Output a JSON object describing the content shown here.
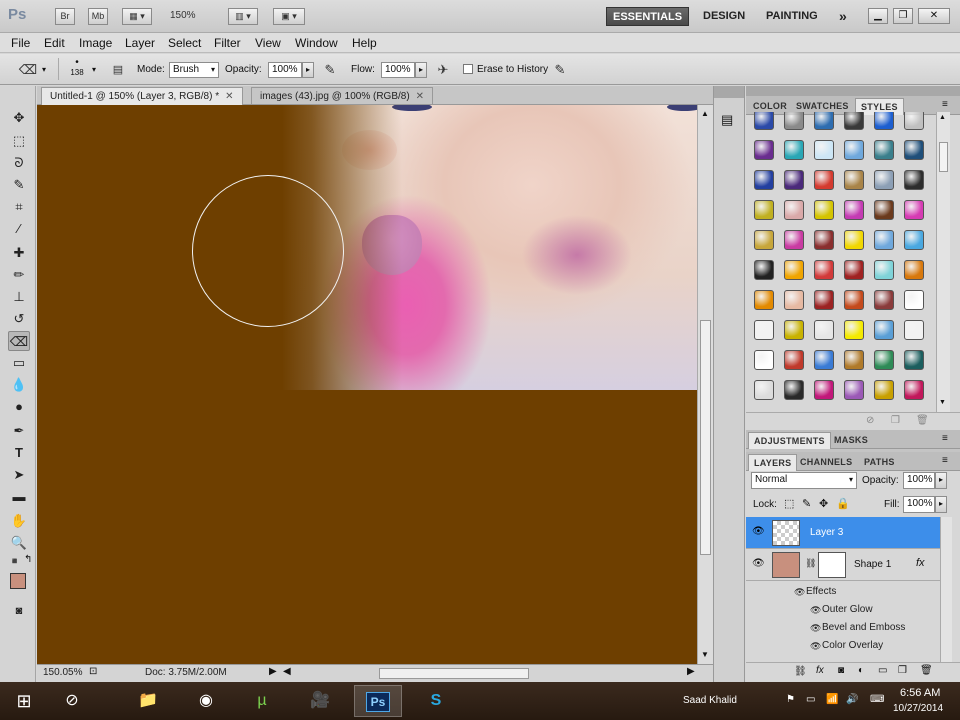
{
  "appbar": {
    "logo": "Ps",
    "bridge_button": "Br",
    "minibridge_button": "Mb",
    "zoom_level": "150%",
    "workspaces": [
      "ESSENTIALS",
      "DESIGN",
      "PAINTING"
    ],
    "more": "»"
  },
  "menu": [
    "File",
    "Edit",
    "Image",
    "Layer",
    "Select",
    "Filter",
    "View",
    "Window",
    "Help"
  ],
  "options": {
    "brush_size": "138",
    "mode_label": "Mode:",
    "mode_value": "Brush",
    "opacity_label": "Opacity:",
    "opacity_value": "100%",
    "flow_label": "Flow:",
    "flow_value": "100%",
    "erase_history_label": "Erase to History"
  },
  "tabs": [
    {
      "label": "Untitled-1 @ 150% (Layer 3, RGB/8) *"
    },
    {
      "label": "images (43).jpg @ 100% (RGB/8)"
    }
  ],
  "status": {
    "zoom": "150.05%",
    "doc": "Doc: 3.75M/2.00M"
  },
  "colors": {
    "canvas_brown": "#6e3f00",
    "foreground": "#c8907e",
    "background": "#ffffff",
    "layer_selected": "#3d8eea"
  },
  "panels": {
    "top_tabs": [
      "COLOR",
      "SWATCHES",
      "STYLES"
    ],
    "adjust_tabs": [
      "ADJUSTMENTS",
      "MASKS"
    ],
    "layers_tabs": [
      "LAYERS",
      "CHANNELS",
      "PATHS"
    ],
    "blend_mode": "Normal",
    "opacity_label": "Opacity:",
    "opacity_value": "100%",
    "lock_label": "Lock:",
    "fill_label": "Fill:",
    "fill_value": "100%"
  },
  "layers": [
    {
      "name": "Layer 3",
      "selected": true
    },
    {
      "name": "Shape 1",
      "selected": false
    }
  ],
  "effects": {
    "header": "Effects",
    "items": [
      "Outer Glow",
      "Bevel and Emboss",
      "Color Overlay"
    ]
  },
  "taskbar": {
    "user": "Saad Khalid",
    "time": "6:56 AM",
    "date": "10/27/2014"
  }
}
